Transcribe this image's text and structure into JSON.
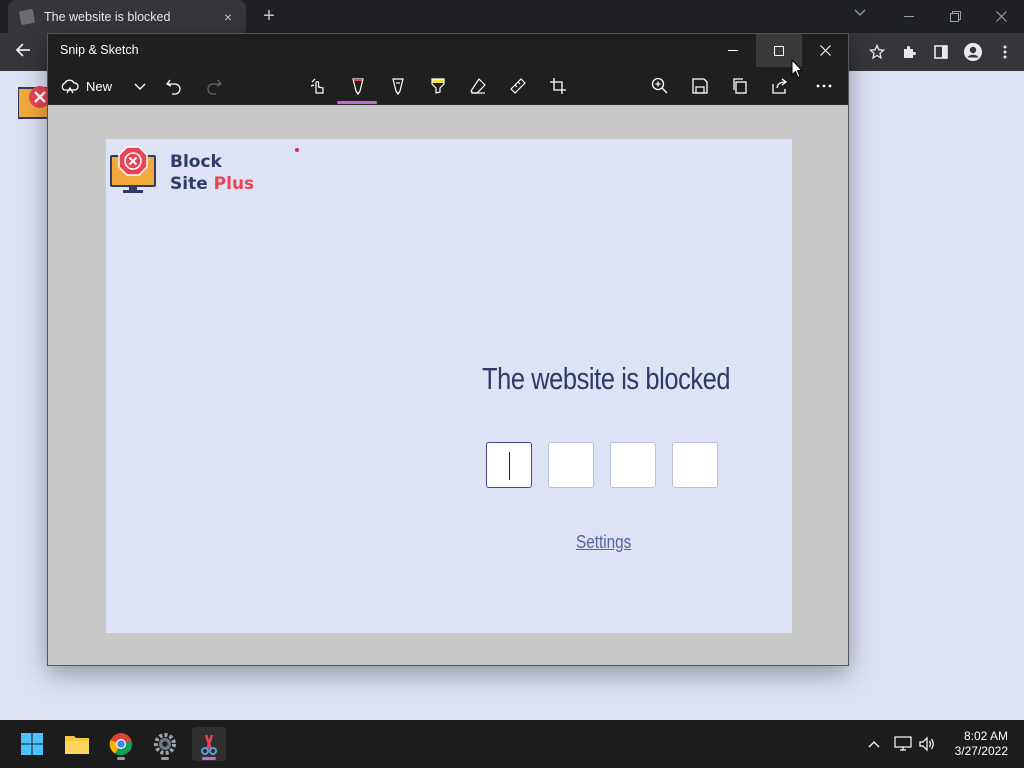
{
  "chrome": {
    "tab_title": "The website is blocked",
    "tab_close": "×",
    "new_tab": "+"
  },
  "snip": {
    "title": "Snip & Sketch",
    "new_label": "New"
  },
  "capture": {
    "brand_line1": "Block",
    "brand_line2_a": "Site ",
    "brand_line2_b": "Plus",
    "heading": "The website is blocked",
    "settings_link": "Settings",
    "pin_length": 4
  },
  "taskbar": {
    "time": "8:02 AM",
    "date": "3/27/2022"
  },
  "colors": {
    "page_bg": "#dde3f5",
    "brand_navy": "#2f3a66",
    "brand_red": "#e84357",
    "accent_pen": "#c569d4"
  }
}
